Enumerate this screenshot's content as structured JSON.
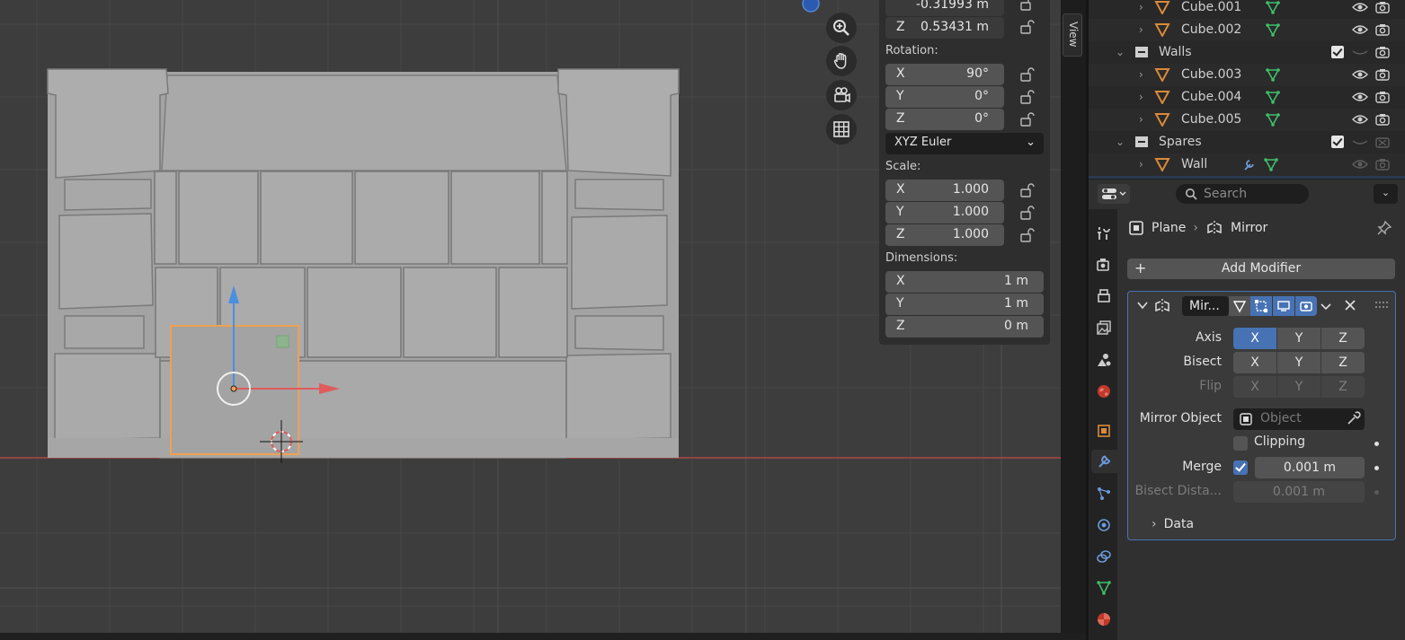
{
  "npanel": {
    "location_y": "-0.31993 m",
    "location_z": "0.53431 m",
    "axis_x": "X",
    "axis_y": "Y",
    "axis_z": "Z",
    "rotation_label": "Rotation:",
    "rotation_x": "90°",
    "rotation_y": "0°",
    "rotation_z": "0°",
    "rotation_mode": "XYZ Euler",
    "scale_label": "Scale:",
    "scale_x": "1.000",
    "scale_y": "1.000",
    "scale_z": "1.000",
    "dimensions_label": "Dimensions:",
    "dim_x": "1 m",
    "dim_y": "1 m",
    "dim_z": "0 m"
  },
  "view_tab": "View",
  "outliner": {
    "rows": [
      {
        "label": "Cube.001"
      },
      {
        "label": "Cube.002"
      },
      {
        "label": "Walls"
      },
      {
        "label": "Cube.003"
      },
      {
        "label": "Cube.004"
      },
      {
        "label": "Cube.005"
      },
      {
        "label": "Spares"
      },
      {
        "label": "Wall"
      }
    ]
  },
  "properties": {
    "search_placeholder": "Search",
    "breadcrumb_object": "Plane",
    "breadcrumb_modifier": "Mirror",
    "add_modifier": "Add Modifier",
    "modifier": {
      "name": "Mir...",
      "axis_label": "Axis",
      "bisect_label": "Bisect",
      "flip_label": "Flip",
      "x": "X",
      "y": "Y",
      "z": "Z",
      "mirror_object_label": "Mirror Object",
      "mirror_object_placeholder": "Object",
      "clipping_label": "Clipping",
      "merge_label": "Merge",
      "merge_value": "0.001 m",
      "bisect_distance_label": "Bisect Dista...",
      "bisect_distance_value": "0.001 m",
      "data_label": "Data"
    }
  },
  "colors": {
    "accent": "#4772b3",
    "selection": "#f0a050",
    "x_axis": "#e05b5b",
    "y_axis": "#4a8fe0",
    "data_green": "#3fbf6a",
    "object_orange": "#d98a3a"
  }
}
